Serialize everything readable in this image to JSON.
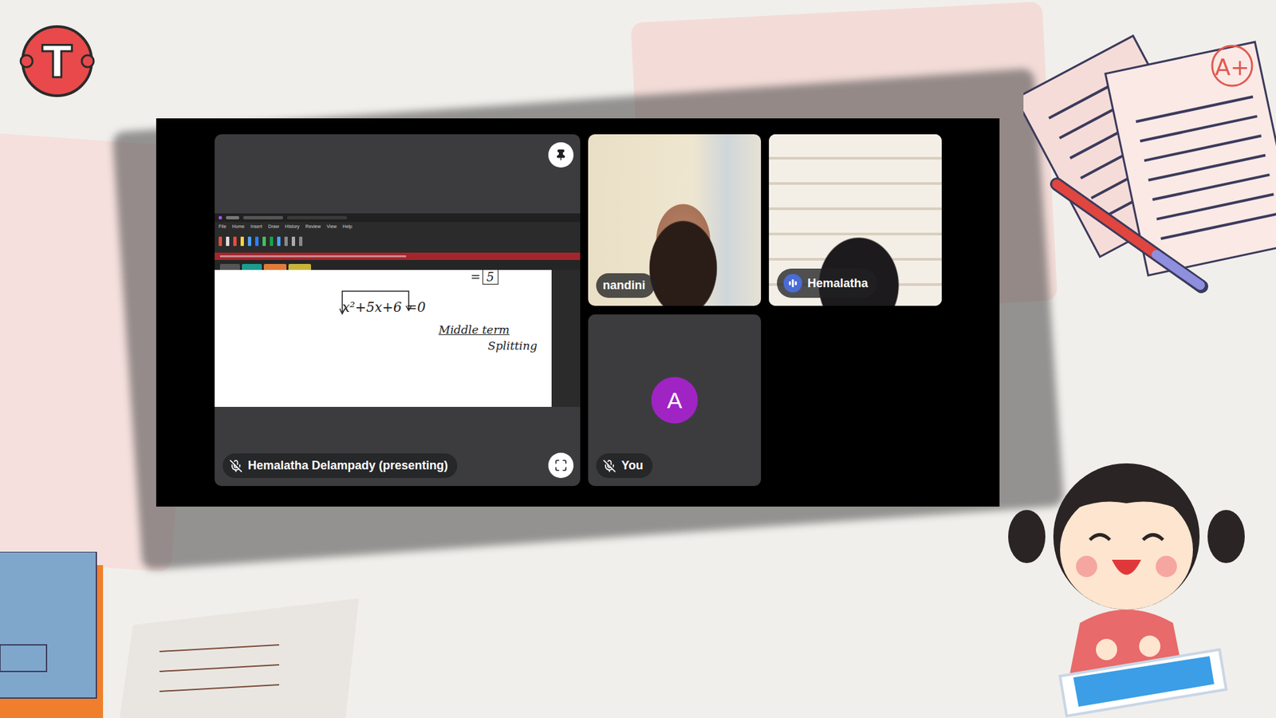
{
  "logo": {
    "letter": "T"
  },
  "grade_badge": "A+",
  "presentation": {
    "label": "Hemalatha Delampady (presenting)",
    "muted": true,
    "pinned": true
  },
  "shared_screen": {
    "menu": [
      "File",
      "Home",
      "Insert",
      "Draw",
      "History",
      "Review",
      "View",
      "Help"
    ],
    "whiteboard": {
      "equation": "x²+5x+6 =0",
      "answer_prefix": "=",
      "answer": "5",
      "notes": [
        "Middle term",
        "Splitting"
      ]
    }
  },
  "participants": [
    {
      "name": "nandini",
      "kind": "video",
      "muted": false,
      "speaking": false
    },
    {
      "name": "Hemalatha",
      "kind": "video",
      "muted": false,
      "speaking": true
    },
    {
      "name": "You",
      "kind": "avatar",
      "initial": "A",
      "muted": true,
      "speaking": false
    }
  ]
}
